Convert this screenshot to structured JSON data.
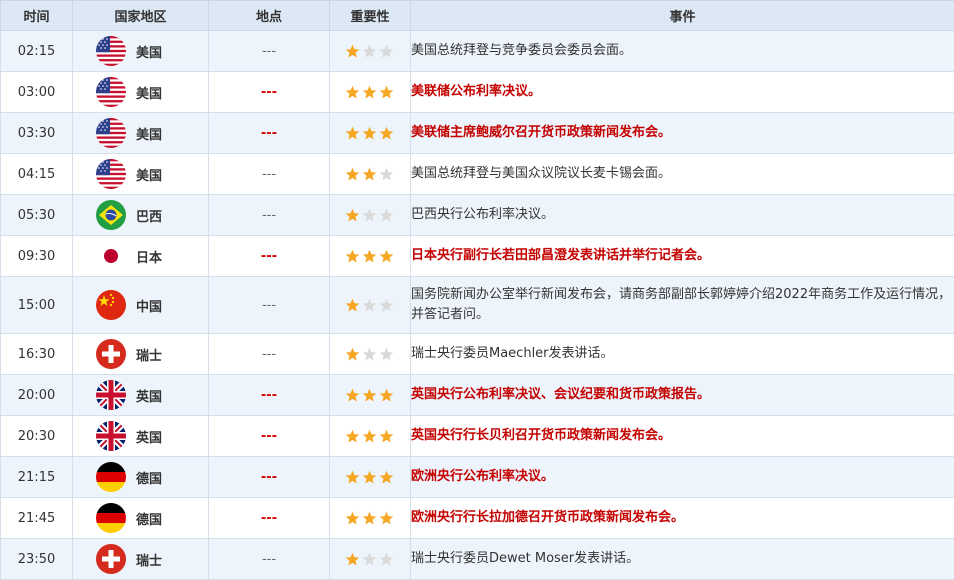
{
  "colors": {
    "header_bg": "#dde8f5",
    "row_alt_bg": "#eef4fb",
    "highlight_red": "#c40000",
    "star_gold": "#f5a623",
    "star_empty": "#d9d9d9"
  },
  "header": {
    "time": "时间",
    "country": "国家地区",
    "location": "地点",
    "importance": "重要性",
    "event": "事件"
  },
  "rows": [
    {
      "time": "02:15",
      "country": "美国",
      "flag": "us-flag-icon",
      "location": "---",
      "stars": 1,
      "event": "美国总统拜登与竞争委员会委员会面。",
      "highlight": false
    },
    {
      "time": "03:00",
      "country": "美国",
      "flag": "us-flag-icon",
      "location": "---",
      "stars": 3,
      "event": "美联储公布利率决议。",
      "highlight": true
    },
    {
      "time": "03:30",
      "country": "美国",
      "flag": "us-flag-icon",
      "location": "---",
      "stars": 3,
      "event": "美联储主席鲍威尔召开货币政策新闻发布会。",
      "highlight": true
    },
    {
      "time": "04:15",
      "country": "美国",
      "flag": "us-flag-icon",
      "location": "---",
      "stars": 2,
      "event": "美国总统拜登与美国众议院议长麦卡锡会面。",
      "highlight": false
    },
    {
      "time": "05:30",
      "country": "巴西",
      "flag": "brazil-flag-icon",
      "location": "---",
      "stars": 1,
      "event": "巴西央行公布利率决议。",
      "highlight": false
    },
    {
      "time": "09:30",
      "country": "日本",
      "flag": "japan-flag-icon",
      "location": "---",
      "stars": 3,
      "event": "日本央行副行长若田部昌澄发表讲话并举行记者会。",
      "highlight": true
    },
    {
      "time": "15:00",
      "country": "中国",
      "flag": "china-flag-icon",
      "location": "---",
      "stars": 1,
      "event": "国务院新闻办公室举行新闻发布会，请商务部副部长郭婷婷介绍2022年商务工作及运行情况，并答记者问。",
      "highlight": false
    },
    {
      "time": "16:30",
      "country": "瑞士",
      "flag": "swiss-flag-icon",
      "location": "---",
      "stars": 1,
      "event": "瑞士央行委员Maechler发表讲话。",
      "highlight": false
    },
    {
      "time": "20:00",
      "country": "英国",
      "flag": "uk-flag-icon",
      "location": "---",
      "stars": 3,
      "event": "英国央行公布利率决议、会议纪要和货币政策报告。",
      "highlight": true
    },
    {
      "time": "20:30",
      "country": "英国",
      "flag": "uk-flag-icon",
      "location": "---",
      "stars": 3,
      "event": "英国央行行长贝利召开货币政策新闻发布会。",
      "highlight": true
    },
    {
      "time": "21:15",
      "country": "德国",
      "flag": "germany-flag-icon",
      "location": "---",
      "stars": 3,
      "event": "欧洲央行公布利率决议。",
      "highlight": true
    },
    {
      "time": "21:45",
      "country": "德国",
      "flag": "germany-flag-icon",
      "location": "---",
      "stars": 3,
      "event": "欧洲央行行长拉加德召开货币政策新闻发布会。",
      "highlight": true
    },
    {
      "time": "23:50",
      "country": "瑞士",
      "flag": "swiss-flag-icon",
      "location": "---",
      "stars": 1,
      "event": "瑞士央行委员Dewet Moser发表讲话。",
      "highlight": false
    }
  ]
}
